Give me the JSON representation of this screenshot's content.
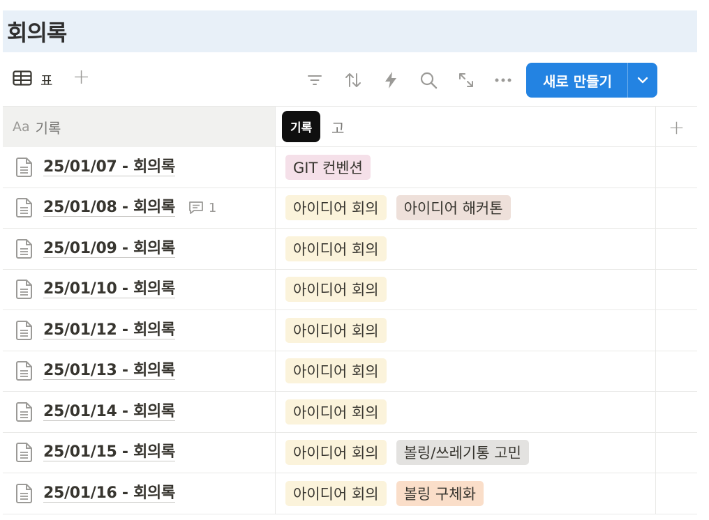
{
  "page": {
    "title": "회의록"
  },
  "toolbar": {
    "view_label": "표",
    "add_view": "+",
    "new_button_label": "새로 만들기"
  },
  "table": {
    "columns": [
      {
        "icon": "Aa",
        "label": "기록"
      },
      {
        "label": "고"
      }
    ],
    "add_column": "+",
    "tooltip": "기록",
    "rows": [
      {
        "title": "25/01/07 - 회의록",
        "tags": [
          {
            "label": "GIT 컨벤션",
            "color": "#f5e0e9"
          }
        ]
      },
      {
        "title": "25/01/08 - 회의록",
        "comment_count": "1",
        "tags": [
          {
            "label": "아이디어 회의",
            "color": "#fbf3db"
          },
          {
            "label": "아이디어 해커톤",
            "color": "#eee0da"
          }
        ]
      },
      {
        "title": "25/01/09 - 회의록",
        "tags": [
          {
            "label": "아이디어 회의",
            "color": "#fbf3db"
          }
        ]
      },
      {
        "title": "25/01/10 - 회의록",
        "tags": [
          {
            "label": "아이디어 회의",
            "color": "#fbf3db"
          }
        ]
      },
      {
        "title": "25/01/12 - 회의록",
        "tags": [
          {
            "label": "아이디어 회의",
            "color": "#fbf3db"
          }
        ]
      },
      {
        "title": "25/01/13 - 회의록",
        "tags": [
          {
            "label": "아이디어 회의",
            "color": "#fbf3db"
          }
        ]
      },
      {
        "title": "25/01/14 - 회의록",
        "tags": [
          {
            "label": "아이디어 회의",
            "color": "#fbf3db"
          }
        ]
      },
      {
        "title": "25/01/15 - 회의록",
        "tags": [
          {
            "label": "아이디어 회의",
            "color": "#fbf3db"
          },
          {
            "label": "볼링/쓰레기통 고민",
            "color": "#e3e2e0"
          }
        ]
      },
      {
        "title": "25/01/16 - 회의록",
        "tags": [
          {
            "label": "아이디어 회의",
            "color": "#fbf3db"
          },
          {
            "label": "볼링 구체화",
            "color": "#fadec9"
          }
        ]
      }
    ]
  },
  "colors": {
    "accent": "#2383e2",
    "title_bar_bg": "#e8f0f8",
    "header_bg": "#f1f1ef"
  },
  "icons": [
    "table-icon",
    "filter-icon",
    "sort-icon",
    "lightning-icon",
    "search-icon",
    "expand-icon",
    "more-icon",
    "chevron-down-icon",
    "document-icon",
    "comment-icon"
  ]
}
